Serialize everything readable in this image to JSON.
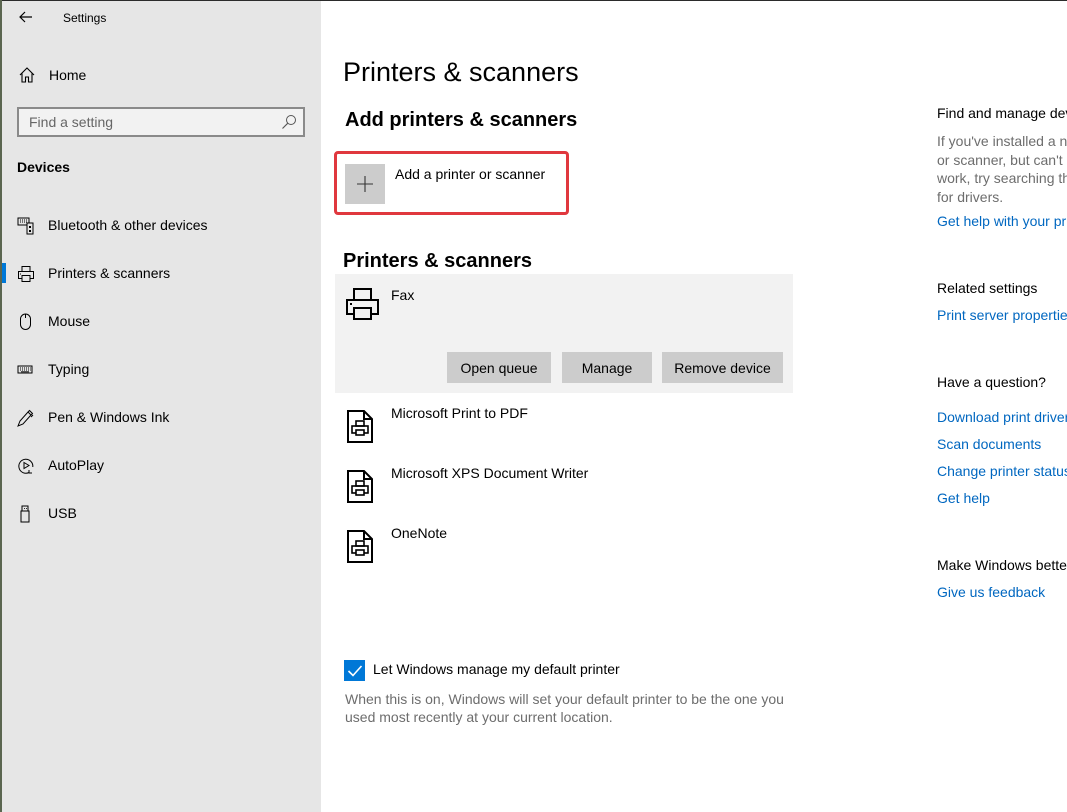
{
  "window": {
    "app_title": "Settings",
    "back_icon": "arrow-left-icon"
  },
  "sidebar": {
    "home": {
      "label": "Home",
      "icon": "home-icon"
    },
    "search": {
      "placeholder": "Find a setting",
      "value": "",
      "icon": "search-icon"
    },
    "section_label": "Devices",
    "items": [
      {
        "label": "Bluetooth & other devices",
        "icon": "bluetooth-devices-icon",
        "active": false
      },
      {
        "label": "Printers & scanners",
        "icon": "printer-icon",
        "active": true
      },
      {
        "label": "Mouse",
        "icon": "mouse-icon",
        "active": false
      },
      {
        "label": "Typing",
        "icon": "keyboard-icon",
        "active": false
      },
      {
        "label": "Pen & Windows Ink",
        "icon": "pen-icon",
        "active": false
      },
      {
        "label": "AutoPlay",
        "icon": "autoplay-icon",
        "active": false
      },
      {
        "label": "USB",
        "icon": "usb-icon",
        "active": false
      }
    ],
    "accent_color": "#0078d7"
  },
  "main": {
    "page_title": "Printers & scanners",
    "add_section": {
      "heading": "Add printers & scanners",
      "add_button_label": "Add a printer or scanner",
      "highlight_color": "#e0383e"
    },
    "list_section": {
      "heading": "Printers & scanners",
      "selected": {
        "name": "Fax",
        "buttons": [
          "Open queue",
          "Manage",
          "Remove device"
        ]
      },
      "printers": [
        {
          "name": "Microsoft Print to PDF"
        },
        {
          "name": "Microsoft XPS Document Writer"
        },
        {
          "name": "OneNote"
        }
      ]
    },
    "default_printer": {
      "checked": true,
      "label": "Let Windows manage my default printer",
      "description": "When this is on, Windows will set your default printer to be the one you used most recently at your current location."
    }
  },
  "right_panel": {
    "find_manage": {
      "heading": "Find and manage devices",
      "text": "If you've installed a new printer or scanner, but can't get it to work, try searching the Internet for drivers.",
      "link": "Get help with your printer"
    },
    "related": {
      "heading": "Related settings",
      "links": [
        "Print server properties"
      ]
    },
    "question": {
      "heading": "Have a question?",
      "links": [
        "Download print drivers",
        "Scan documents",
        "Change printer status",
        "Get help"
      ]
    },
    "feedback": {
      "heading": "Make Windows better",
      "link": "Give us feedback"
    },
    "link_color": "#0067c0"
  }
}
